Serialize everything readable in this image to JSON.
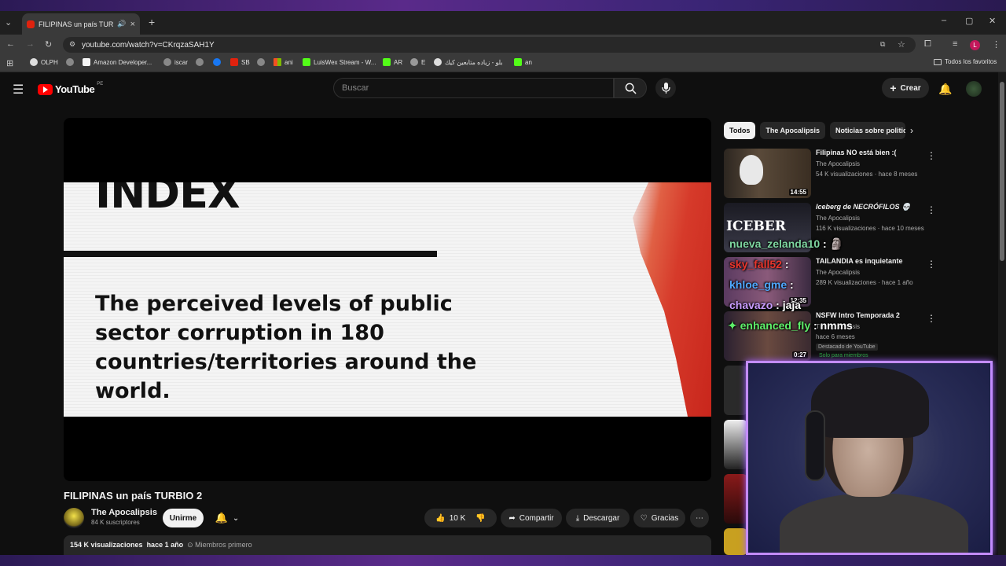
{
  "browser": {
    "tab_title": "FILIPINAS un país TURBIO 2",
    "url": "youtube.com/watch?v=CKrqzaSAH1Y",
    "bookmarks": [
      "OLPH",
      "Amazon Developer...",
      "iscar",
      "SB",
      "ani",
      "LuisWex Stream - W...",
      "AR",
      "E",
      "بلو - زياده متابعين كيك",
      "an"
    ],
    "all_bookmarks": "Todos los favoritos",
    "profile_initial": "L"
  },
  "youtube": {
    "logo_text": "YouTube",
    "country_code": "PE",
    "search_placeholder": "Buscar",
    "create_label": "Crear"
  },
  "video": {
    "slide_heading": "INDEX",
    "slide_text": "The perceived levels of public sector corruption in 180 countries/territories around the world.",
    "title": "FILIPINAS un país TURBIO 2",
    "channel": "The Apocalipsis",
    "subscribers": "84 K suscriptores",
    "join_label": "Unirme",
    "likes": "10 K",
    "share_label": "Compartir",
    "download_label": "Descargar",
    "thanks_label": "Gracias",
    "views": "154 K visualizaciones",
    "age": "hace 1 año",
    "members_first": "Miembros primero"
  },
  "sidebar": {
    "chips": [
      "Todos",
      "The Apocalipsis",
      "Noticias sobre politic"
    ],
    "recommendations": [
      {
        "title": "Filipinas NO está bien :(",
        "channel": "The Apocalipsis",
        "meta": "54 K visualizaciones · hace 8 meses",
        "duration": "14:55"
      },
      {
        "title": "Iceberg de NECRÓFILOS 💀",
        "channel": "The Apocalipsis",
        "meta": "116 K visualizaciones · hace 10 meses",
        "thumb_text": "ICEBER"
      },
      {
        "title": "TAILANDIA es inquietante",
        "channel": "The Apocalipsis",
        "meta": "289 K visualizaciones · hace 1 año",
        "duration": "12:35"
      },
      {
        "title": "NSFW Intro Temporada 2",
        "channel": "The Apocalipsis",
        "meta": "hace 6 meses",
        "duration": "0:27",
        "badge": "Destacado de YouTube",
        "members": "Solo para miembros"
      }
    ]
  },
  "chat": [
    {
      "user": "nueva_zelanda10",
      "message": "🗿",
      "color": "#7ed6a0"
    },
    {
      "user": "sky_fall52",
      "message": "",
      "color": "#e8352c"
    },
    {
      "user": "khloe_gme",
      "message": "",
      "color": "#4fa8ff"
    },
    {
      "user": "chavazo",
      "message": "jaja",
      "color": "#c99cff"
    },
    {
      "user": "enhanced_fly",
      "message": "nmms",
      "color": "#5ef06a"
    }
  ]
}
